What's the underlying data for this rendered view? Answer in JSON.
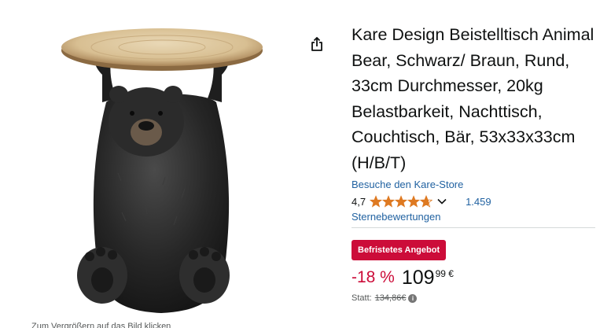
{
  "product": {
    "title": "Kare Design Beistelltisch Animal Bear, Schwarz/ Braun, Rund, 33cm Durchmesser, 20kg Belastbarkeit, Nachttisch, Couchtisch, Bär, 53x33x33cm (H/B/T)",
    "store_link": "Besuche den Kare-Store",
    "image_caption": "Zum Vergrößern auf das Bild klicken"
  },
  "rating": {
    "value": "4,7",
    "stars": 4.7,
    "count": "1.459",
    "label": "Sternebewertungen"
  },
  "deal": {
    "badge": "Befristetes Angebot"
  },
  "price": {
    "discount": "-18 %",
    "whole": "109",
    "fraction": "99 €",
    "list_label": "Statt:",
    "list_price": "134,86€"
  },
  "colors": {
    "link": "#2162a1",
    "star": "#de7921",
    "deal": "#cc0c39"
  },
  "icons": {
    "share": "share-icon",
    "chevron": "chevron-down-icon",
    "info": "info-icon"
  }
}
